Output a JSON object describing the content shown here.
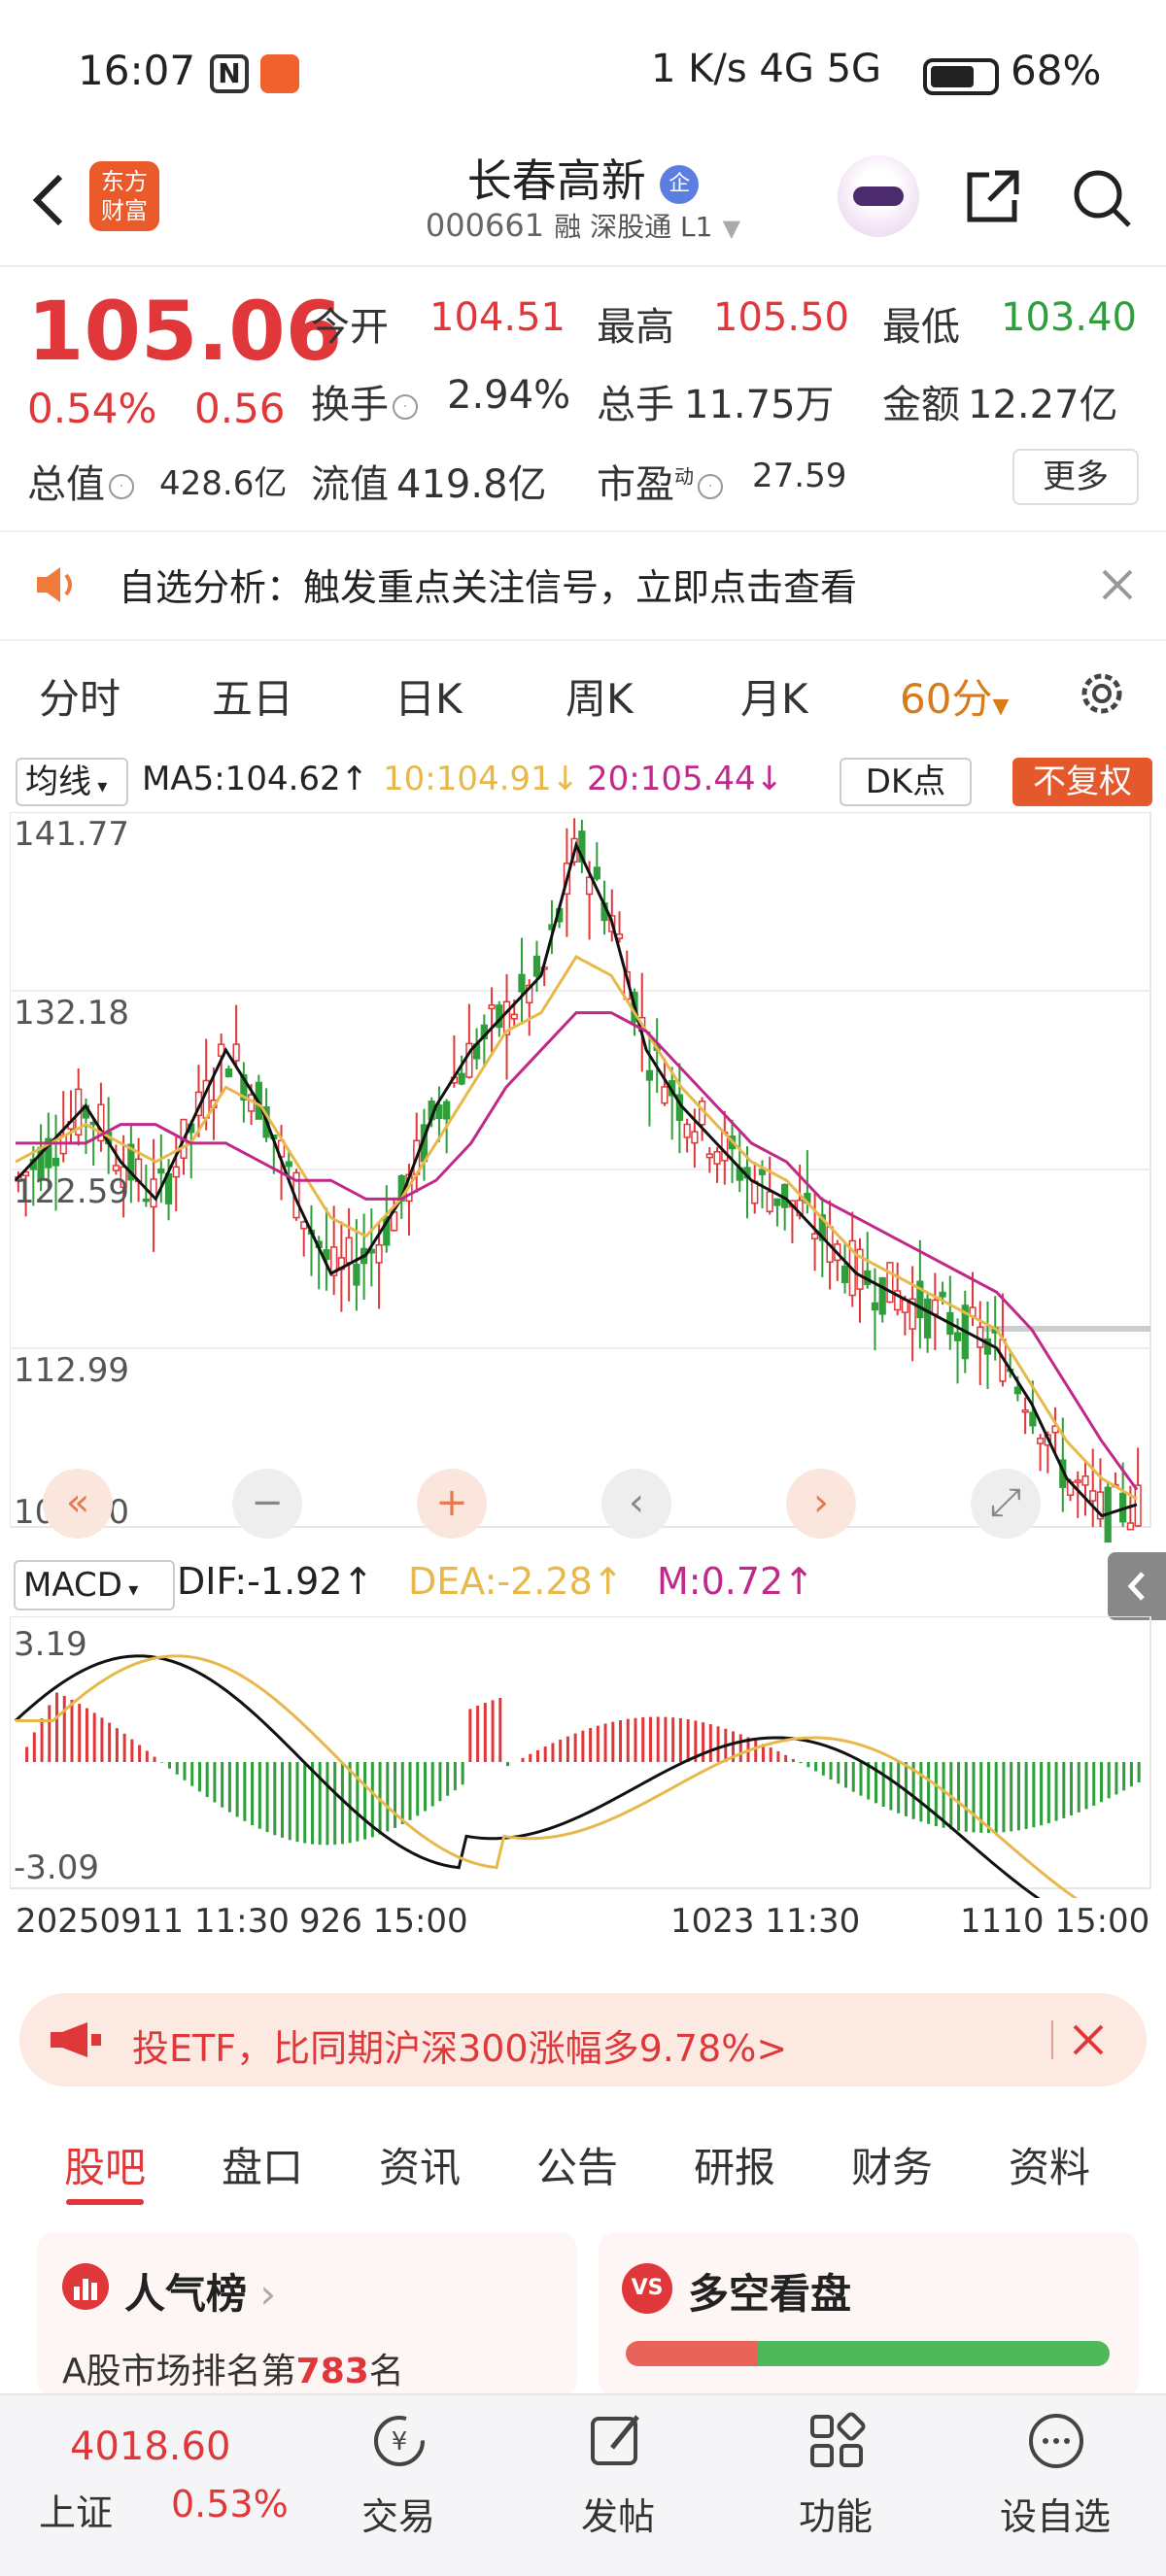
{
  "status_bar": {
    "time": "16:07",
    "network": "1 K/s  4G  5G",
    "battery": "68%"
  },
  "header": {
    "logo_text": [
      "东方",
      "财富"
    ],
    "title": "长春高新",
    "title_badge": "企",
    "code": "000661",
    "tags": "融 深股通 L1"
  },
  "quote": {
    "price": "105.06",
    "change_pct": "0.54%",
    "change_amt": "0.56",
    "open_label": "今开",
    "open": "104.51",
    "high_label": "最高",
    "high": "105.50",
    "low_label": "最低",
    "low": "103.40",
    "turnover_label": "换手",
    "turnover": "2.94%",
    "volume_label": "总手",
    "volume": "11.75万",
    "amount_label": "金额",
    "amount": "12.27亿",
    "mktcap_label": "总值",
    "mktcap": "428.6亿",
    "float_label": "流值",
    "float": "419.8亿",
    "pe_label": "市盈",
    "pe_sup": "动",
    "pe": "27.59",
    "more_button": "更多"
  },
  "notice": {
    "text": "自选分析：触发重点关注信号，立即点击查看"
  },
  "chart_tabs": [
    "分时",
    "五日",
    "日K",
    "周K",
    "月K",
    "60分"
  ],
  "chart_tabs_active": "60分",
  "ma_row": {
    "selector": "均线",
    "ma5": "MA5:104.62↑",
    "ma10": "10:104.91↓",
    "ma20": "20:105.44↓",
    "dk": "DK点",
    "adjust": "不复权"
  },
  "colors": {
    "red": "#e0383a",
    "green": "#2e9f3a",
    "ma5": "#111111",
    "ma10": "#e8b84a",
    "ma20": "#c0288a",
    "accent": "#d87b1a"
  },
  "kline_axis": [
    "141.77",
    "132.18",
    "122.59",
    "112.99",
    "103.40"
  ],
  "kline_controls": [
    "rewind-icon",
    "zoom-out-icon",
    "zoom-in-icon",
    "left-icon",
    "right-icon"
  ],
  "macd": {
    "selector": "MACD",
    "dif": "DIF:-1.92↑",
    "dea": "DEA:-2.28↑",
    "m": "M:0.72↑",
    "axis_top": "3.19",
    "axis_bottom": "-3.09"
  },
  "date_labels": [
    "20250911 11:30",
    "926 15:00",
    "1023 11:30",
    "1110 15:00"
  ],
  "chart_data": {
    "type": "line",
    "title": "",
    "series": [
      {
        "name": "MA5",
        "values": [
          122,
          124,
          126,
          123,
          121,
          125,
          129,
          126,
          121,
          117,
          118,
          121,
          126,
          129,
          131,
          133,
          140,
          136,
          129,
          126,
          124,
          122,
          121,
          119,
          117,
          116,
          115,
          114,
          113,
          110,
          106,
          104,
          104.6
        ]
      },
      {
        "name": "10",
        "values": [
          123,
          124,
          125,
          124,
          123,
          124,
          127,
          126,
          123,
          120,
          119,
          121,
          124,
          127,
          130,
          131,
          134,
          133,
          130,
          127,
          125,
          123,
          122,
          120,
          118,
          117,
          116,
          115,
          114,
          111,
          108,
          106,
          104.9
        ]
      },
      {
        "name": "20",
        "values": [
          124,
          124,
          124,
          125,
          125,
          124,
          124,
          123,
          122,
          122,
          121,
          121,
          122,
          124,
          127,
          129,
          131,
          131,
          130,
          128,
          126,
          124,
          123,
          121,
          120,
          119,
          118,
          117,
          116,
          114,
          111,
          108,
          105.4
        ]
      }
    ],
    "ylim": [
      103.4,
      141.77
    ]
  },
  "promo": {
    "text": "投ETF，比同期沪深300涨幅多9.78%>"
  },
  "bottom_tabs": [
    "股吧",
    "盘口",
    "资讯",
    "公告",
    "研报",
    "财务",
    "资料"
  ],
  "cards": {
    "popularity_title": "人气榜",
    "popularity_sub_pre": "A股市场排名第",
    "popularity_rank": "783",
    "popularity_sub_post": "名",
    "bull_bear_title": "多空看盘"
  },
  "bottom_nav": {
    "index_value": "4018.60",
    "index_name": "上证",
    "index_pct": "0.53%",
    "items": [
      "交易",
      "发帖",
      "功能",
      "设自选"
    ]
  }
}
